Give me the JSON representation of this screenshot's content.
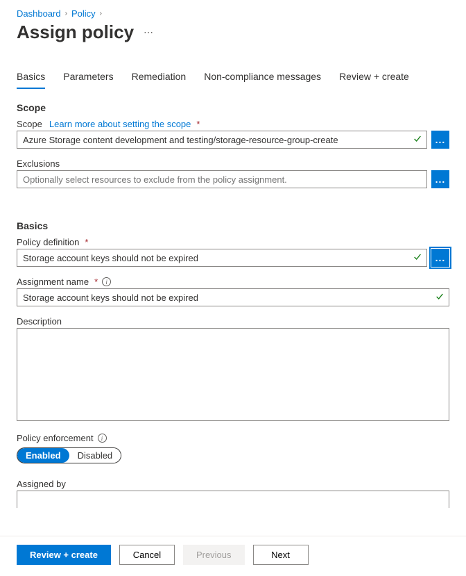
{
  "breadcrumb": {
    "items": [
      "Dashboard",
      "Policy"
    ]
  },
  "page": {
    "title": "Assign policy"
  },
  "tabs": {
    "items": [
      {
        "label": "Basics",
        "active": true
      },
      {
        "label": "Parameters",
        "active": false
      },
      {
        "label": "Remediation",
        "active": false
      },
      {
        "label": "Non-compliance messages",
        "active": false
      },
      {
        "label": "Review + create",
        "active": false
      }
    ]
  },
  "sections": {
    "scope_heading": "Scope",
    "basics_heading": "Basics"
  },
  "scope": {
    "label": "Scope",
    "learn_more": "Learn more about setting the scope",
    "value": "Azure Storage content development and testing/storage-resource-group-create",
    "exclusions_label": "Exclusions",
    "exclusions_placeholder": "Optionally select resources to exclude from the policy assignment."
  },
  "basics": {
    "policy_definition_label": "Policy definition",
    "policy_definition_value": "Storage account keys should not be expired",
    "assignment_name_label": "Assignment name",
    "assignment_name_value": "Storage account keys should not be expired",
    "description_label": "Description",
    "description_value": "",
    "policy_enforcement_label": "Policy enforcement",
    "enforcement_enabled": "Enabled",
    "enforcement_disabled": "Disabled",
    "assigned_by_label": "Assigned by",
    "assigned_by_value": ""
  },
  "footer": {
    "review_create": "Review + create",
    "cancel": "Cancel",
    "previous": "Previous",
    "next": "Next"
  }
}
